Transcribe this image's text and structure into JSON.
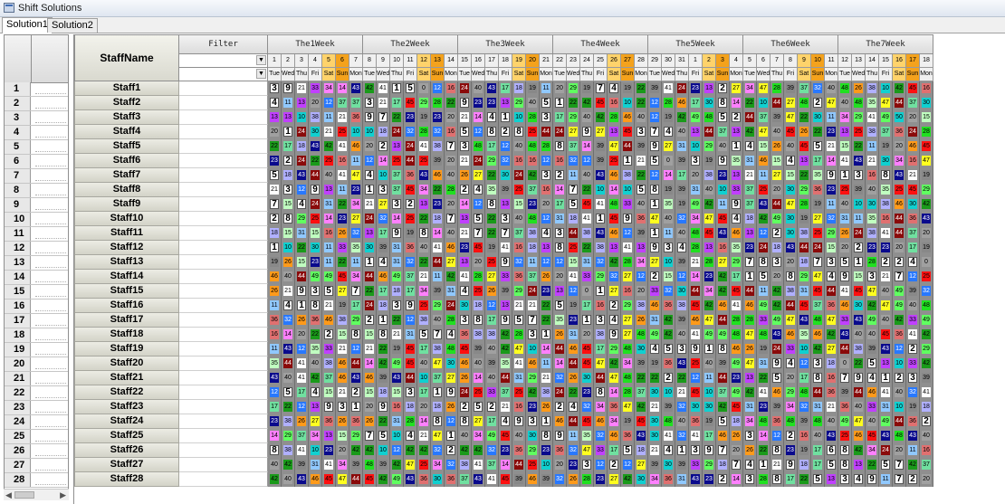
{
  "window": {
    "title": "Shift Solutions",
    "icon": "app-window-icon"
  },
  "tabs": [
    {
      "label": "Solution1",
      "active": true
    },
    {
      "label": "Solution2",
      "active": false
    }
  ],
  "grid": {
    "name_header": "StaffName",
    "filter_header": "Filter",
    "weeks": [
      "The1Week",
      "The2Week",
      "The3Week",
      "The4Week",
      "The5Week",
      "The6Week",
      "The7Week"
    ],
    "day_numbers": [
      "1",
      "2",
      "3",
      "4",
      "5",
      "6",
      "7",
      "8",
      "9",
      "10",
      "11",
      "12",
      "13",
      "14",
      "15",
      "16",
      "17",
      "18",
      "19",
      "20",
      "21",
      "22",
      "23",
      "24",
      "25",
      "26",
      "27",
      "28",
      "29",
      "30",
      "31",
      "1",
      "2",
      "3",
      "4",
      "5",
      "6",
      "7",
      "8",
      "9",
      "10",
      "11",
      "12",
      "13",
      "14",
      "15",
      "16",
      "17",
      "18"
    ],
    "day_names": [
      "Tue",
      "Wed",
      "Thu",
      "Fri",
      "Sat",
      "Sun",
      "Mon",
      "Tue",
      "Wed",
      "Thu",
      "Fri",
      "Sat",
      "Sun",
      "Mon",
      "Tue",
      "Wed",
      "Thu",
      "Fri",
      "Sat",
      "Sun",
      "Mon",
      "Tue",
      "Wed",
      "Thu",
      "Fri",
      "Sat",
      "Sun",
      "Mon",
      "Tue",
      "Wed",
      "Thu",
      "Fri",
      "Sat",
      "Sun",
      "Mon",
      "Tue",
      "Wed",
      "Thu",
      "Fri",
      "Sat",
      "Sun",
      "Mon",
      "Tue",
      "Wed",
      "Thu",
      "Fri",
      "Sat",
      "Sun",
      "Mon"
    ],
    "weekend_colors": {
      "sat": "#ffd36b",
      "sun": "#f4a21c"
    },
    "shift_palette": [
      "#a0a0a0",
      "#ffffff",
      "#1a9a1a",
      "#0a0a8c",
      "#8a0a0a",
      "#ff1010",
      "#ff9a1a",
      "#ffff20",
      "#20e020",
      "#60ff60",
      "#10d0d0",
      "#90c8ff",
      "#2878ff",
      "#c040ff",
      "#ff80ff",
      "#c0ffc0",
      "#e07070",
      "#70e0a0",
      "#b0b0ff",
      "#888888"
    ],
    "big_codes": [
      "1",
      "2",
      "3",
      "4",
      "5",
      "6",
      "7",
      "8",
      "9"
    ],
    "rows": [
      {
        "num": "1",
        "name": "Staff1",
        "codes": "3 9 21 33 34 14 43 42 41 1 5 0 12 16 24 40 43 17 18 19 11 20 29 19 7 4 19 22 39 41 24 23 13 2 27 34 47 28 39 37 32 40 48 26 38 10 42 45 16"
      },
      {
        "num": "2",
        "name": "Staff2",
        "codes": "4 11 13 20 12 37 37 3 21 17 45 29 28 22 9 23 23 13 29 40 5 1 22 42 45 16 10 22 12 28 46 17 30 8 14 22 10 44 27 48 2 47 40 48 35 47 44 37 30"
      },
      {
        "num": "3",
        "name": "Staff3",
        "codes": "13 13 10 38 11 21 36 9 7 22 23 19 23 20 21 14 4 1 10 28 3 17 29 40 42 28 46 40 12 19 42 49 48 5 2 44 37 39 47 22 30 11 34 29 41 49 50 20 15"
      },
      {
        "num": "4",
        "name": "Staff4",
        "codes": "20 1 24 30 21 25 10 10 18 24 32 28 32 16 5 12 8 2 8 25 44 24 27 9 27 13 45 3 7 4 40 13 44 37 13 42 47 40 45 26 22 23 13 25 38 37 36 24 28"
      },
      {
        "num": "5",
        "name": "Staff5",
        "codes": "22 17 18 43 42 41 46 20 2 13 24 41 38 7 3 48 17 12 40 48 28 8 37 14 39 47 44 39 9 27 31 10 29 40 1 4 15 26 40 45 5 21 15 22 11 19 20 46 45"
      },
      {
        "num": "6",
        "name": "Staff6",
        "codes": "23 2 24 22 25 16 11 12 14 25 44 25 39 20 21 24 29 32 16 16 12 16 32 12 39 25 1 21 5 0 39 3 19 9 35 31 46 15 4 13 17 14 41 43 21 30 34 16 47"
      },
      {
        "num": "7",
        "name": "Staff7",
        "codes": "5 18 43 44 40 41 47 4 10 37 36 43 46 40 26 27 22 30 24 42 3 2 11 40 43 46 38 22 12 14 17 20 38 23 13 21 11 27 15 22 35 9 1 3 16 8 43 21 19"
      },
      {
        "num": "8",
        "name": "Staff8",
        "codes": "21 3 12 9 13 11 23 1 3 37 45 34 22 28 2 4 35 39 25 37 16 14 7 22 10 14 10 5 8 19 39 31 40 10 33 37 25 20 30 29 36 23 25 39 40 35 25 45 29"
      },
      {
        "num": "9",
        "name": "Staff9",
        "codes": "7 15 4 24 31 22 34 21 27 3 2 13 23 20 14 12 8 13 15 23 20 17 5 45 41 48 33 40 1 35 19 49 42 11 9 37 43 44 47 28 19 11 40 10 30 38 46 30 42"
      },
      {
        "num": "10",
        "name": "Staff10",
        "codes": "2 8 29 25 14 23 27 24 32 14 25 22 18 7 13 5 22 3 40 48 12 31 18 41 1 45 9 36 47 40 32 34 47 45 4 18 42 49 30 19 27 32 31 11 35 16 44 36 43"
      },
      {
        "num": "11",
        "name": "Staff11",
        "codes": "18 15 31 15 16 26 32 13 17 9 19 8 14 40 21 7 22 7 37 38 4 3 44 38 43 46 12 39 1 11 40 48 45 43 46 13 12 2 30 38 25 29 26 24 38 41 44 37 20"
      },
      {
        "num": "12",
        "name": "Staff12",
        "codes": "1 10 22 30 11 33 35 30 39 31 36 40 41 46 23 45 19 41 16 18 13 8 25 22 38 13 41 13 9 3 4 28 13 16 35 23 24 18 43 44 24 15 20 2 23 23 20 17 19"
      },
      {
        "num": "13",
        "name": "Staff13",
        "codes": "19 26 15 23 11 22 11 1 4 31 32 22 44 27 13 20 25 9 32 11 12 12 15 31 32 42 28 34 27 10 39 21 28 27 29 7 8 3 20 18 7 3 5 1 28 2 2 4 0"
      },
      {
        "num": "14",
        "name": "Staff14",
        "codes": "46 40 44 49 49 45 34 44 46 49 37 21 11 42 41 28 27 33 36 37 26 20 41 33 29 32 27 12 2 15 12 14 23 42 17 1 5 20 8 29 47 4 9 15 3 21 7 12 25"
      },
      {
        "num": "15",
        "name": "Staff15",
        "codes": "26 21 9 3 5 27 7 22 17 18 17 34 39 31 4 25 26 39 29 24 23 13 12 0 1 27 16 20 33 32 30 44 34 42 45 44 11 42 38 31 45 44 41 45 47 40 49 39 32"
      },
      {
        "num": "16",
        "name": "Staff16",
        "codes": "11 4 1 8 21 19 17 24 18 3 9 25 29 24 30 18 12 13 21 21 22 5 19 17 16 2 29 38 46 36 38 45 42 46 41 46 49 42 44 45 37 36 46 30 42 47 49 40 48"
      },
      {
        "num": "17",
        "name": "Staff17",
        "codes": "36 32 26 36 46 38 29 2 1 22 12 38 40 28 3 8 17 9 5 7 22 35 23 1 3 4 27 26 31 42 39 46 47 44 28 28 33 49 47 43 48 47 33 43 49 40 42 33 49"
      },
      {
        "num": "18",
        "name": "Staff18",
        "codes": "16 14 20 22 2 15 8 15 8 21 31 5 7 4 36 38 38 42 28 3 1 26 31 20 38 9 27 48 49 42 40 41 49 49 48 47 48 43 46 35 46 42 43 40 40 45 36 41 42"
      },
      {
        "num": "19",
        "name": "Staff19",
        "codes": "11 43 12 35 33 21 12 21 22 19 45 17 38 48 45 39 40 42 47 10 14 44 46 45 17 29 48 30 4 5 3 9 1 8 46 26 19 24 33 10 42 27 44 38 39 43 12 2 29"
      },
      {
        "num": "20",
        "name": "Staff20",
        "codes": "35 44 41 40 38 46 44 14 42 49 45 40 47 30 46 40 39 35 41 46 11 14 44 45 47 42 34 39 19 36 43 25 40 39 49 47 31 9 4 12 3 18 0 22 5 13 10 33 42"
      },
      {
        "num": "21",
        "name": "Staff21",
        "codes": "43 40 41 42 37 46 43 46 39 43 44 10 37 27 26 14 40 44 31 29 21 32 26 30 44 47 48 22 22 2 22 12 11 44 23 13 22 5 20 17 8 16 7 9 4 1 2 3 39"
      },
      {
        "num": "22",
        "name": "Staff22",
        "codes": "12 5 17 4 15 21 2 15 18 15 3 17 1 9 24 25 33 37 25 42 38 24 22 23 8 14 28 37 30 10 21 45 10 37 49 42 41 46 29 48 44 36 39 44 46 41 40 32 41"
      },
      {
        "num": "23",
        "name": "Staff23",
        "codes": "17 22 12 13 9 3 1 20 9 16 18 20 18 26 2 5 2 21 16 23 26 2 4 32 34 36 47 42 21 39 32 30 30 42 45 31 23 39 34 32 31 21 36 40 33 31 10 19 18"
      },
      {
        "num": "24",
        "name": "Staff24",
        "codes": "23 38 26 27 36 26 36 26 22 31 28 14 8 12 8 27 17 4 9 3 1 46 44 45 46 34 19 45 30 48 40 36 19 5 18 34 48 36 48 39 48 40 49 47 40 49 44 36 2"
      },
      {
        "num": "25",
        "name": "Staff25",
        "codes": "14 29 37 34 13 15 29 7 5 10 4 21 47 1 40 34 49 45 40 30 8 9 11 35 32 46 36 43 30 41 32 41 17 46 26 3 14 12 2 16 40 43 25 46 45 43 48 43 40"
      },
      {
        "num": "26",
        "name": "Staff26",
        "codes": "8 38 41 10 23 20 42 42 10 12 42 42 32 2 42 42 32 23 36 29 23 36 32 47 33 17 5 18 21 4 1 3 9 7 20 26 22 8 23 19 17 6 8 42 34 24 20 11 16"
      },
      {
        "num": "27",
        "name": "Staff27",
        "codes": "40 42 39 31 41 34 39 48 39 42 47 25 34 32 38 41 37 14 44 25 10 20 23 3 12 2 12 27 39 30 39 33 29 18 7 4 1 21 9 18 17 5 8 13 22 5 7 42 37"
      },
      {
        "num": "28",
        "name": "Staff28",
        "codes": "42 40 43 46 45 47 44 45 42 49 43 36 30 36 37 43 41 45 39 46 39 32 26 28 23 27 42 30 34 36 31 43 23 2 14 3 28 8 17 22 5 13 3 4 9 11 7 2 20"
      }
    ]
  }
}
